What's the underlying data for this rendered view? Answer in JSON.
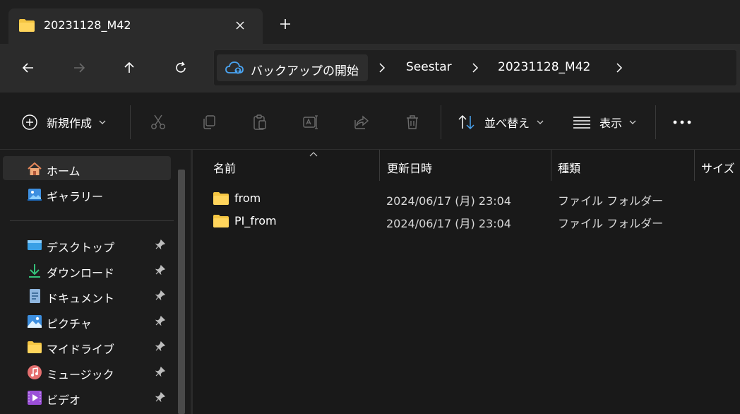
{
  "window": {
    "tab_title": "20231128_M42",
    "close_tab_glyph": "✕",
    "new_tab_glyph": "+"
  },
  "nav": {
    "back_glyph": "←",
    "forward_glyph": "→",
    "up_glyph": "↑",
    "refresh_glyph": "↻",
    "breadcrumbs": [
      "バックアップの開始",
      "Seestar",
      "20231128_M42"
    ]
  },
  "toolbar": {
    "new_label": "新規作成",
    "sort_label": "並べ替え",
    "view_label": "表示",
    "more_glyph": "•••"
  },
  "sidebar": {
    "items": [
      {
        "label": "ホーム",
        "icon": "home-icon"
      },
      {
        "label": "ギャラリー",
        "icon": "gallery-icon"
      },
      {
        "label": "デスクトップ",
        "icon": "desktop-icon"
      },
      {
        "label": "ダウンロード",
        "icon": "download-icon"
      },
      {
        "label": "ドキュメント",
        "icon": "document-icon"
      },
      {
        "label": "ピクチャ",
        "icon": "pictures-icon"
      },
      {
        "label": "マイドライブ",
        "icon": "folder-icon"
      },
      {
        "label": "ミュージック",
        "icon": "music-icon"
      },
      {
        "label": "ビデオ",
        "icon": "video-icon"
      }
    ]
  },
  "columns": {
    "name": "名前",
    "modified": "更新日時",
    "type": "種類",
    "size": "サイズ"
  },
  "files": [
    {
      "name": "from",
      "modified": "2024/06/17 (月) 23:04",
      "type": "ファイル フォルダー"
    },
    {
      "name": "PI_from",
      "modified": "2024/06/17 (月) 23:04",
      "type": "ファイル フォルダー"
    }
  ],
  "colors": {
    "folder": "#f4c542",
    "accent": "#4aa3f0"
  }
}
